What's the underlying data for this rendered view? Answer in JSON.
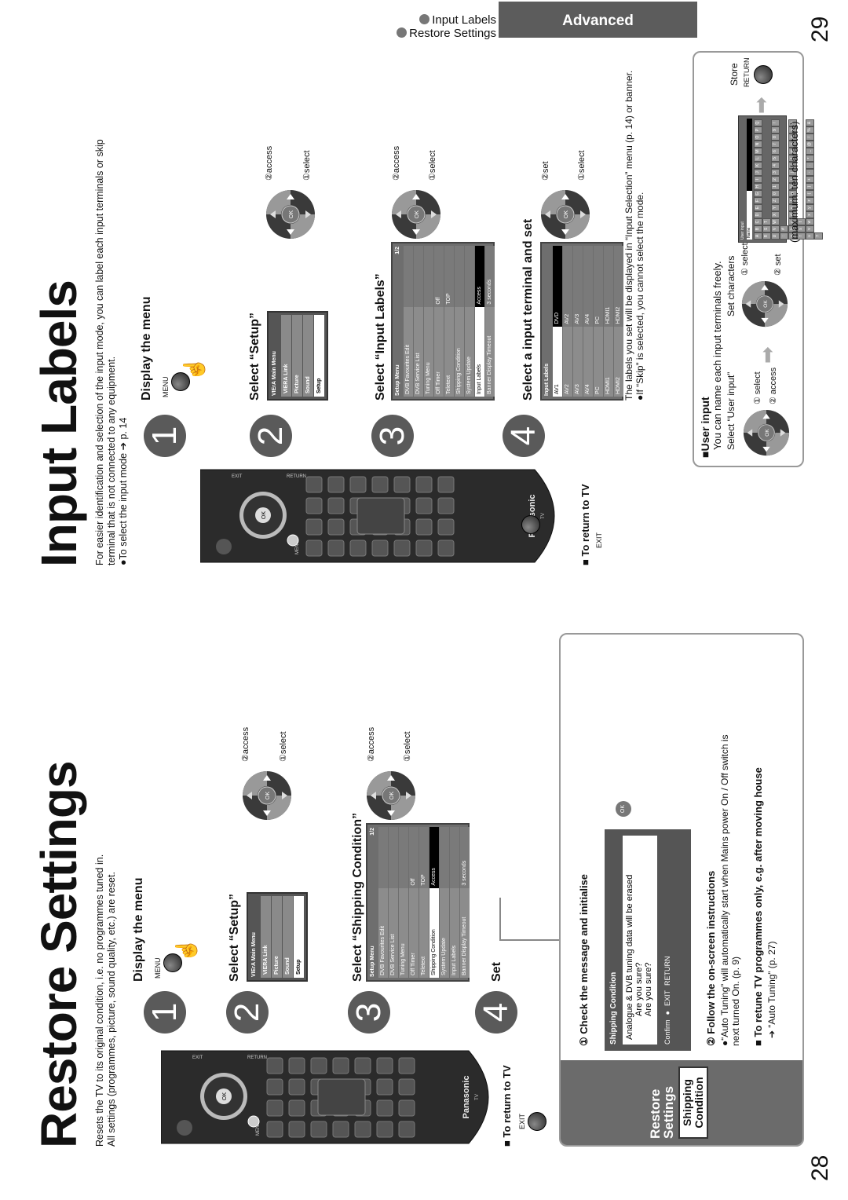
{
  "header": {
    "tab": "Advanced",
    "links": [
      "Input Labels",
      "Restore Settings"
    ]
  },
  "colors": {
    "tab_bg": "#5c5c5c",
    "step_circle": "#5a5a5a",
    "sidebar_bg": "#6b6b6b"
  },
  "left": {
    "page_number": "28",
    "title": "Restore Settings",
    "intro": [
      "Resets the TV to its original condition, i.e. no programmes tuned in.",
      "All settings (programmes, picture, sound quality, etc.) are reset."
    ],
    "remote": {
      "brand": "Panasonic",
      "sub": "TV",
      "menu": "MENU",
      "exit": "EXIT",
      "return": "RETURN",
      "ok": "OK"
    },
    "steps": [
      {
        "num": "1",
        "heading": "Display the menu",
        "button": "MENU"
      },
      {
        "num": "2",
        "heading": "Select “Setup”",
        "access": "②access",
        "select": "①select"
      },
      {
        "num": "3",
        "heading": "Select “Shipping Condition”",
        "access": "②access",
        "select": "①select"
      },
      {
        "num": "4",
        "heading": "Set"
      }
    ],
    "return_tv": {
      "label": "■ To return to TV",
      "button": "EXIT"
    },
    "main_menu": {
      "title": "VIErA Main Menu",
      "items": [
        "VIERA Link",
        "Picture",
        "Sound",
        "Setup"
      ],
      "selected": 3
    },
    "setup_menu": {
      "title": "Setup Menu",
      "page": "1/2",
      "rows": [
        [
          "DVB Favourites Edit",
          ""
        ],
        [
          "DVB Service List",
          ""
        ],
        [
          "Tuning Menu",
          ""
        ],
        [
          "Off Timer",
          "Off"
        ],
        [
          "Teletext",
          "TOP"
        ],
        [
          "Shipping Condition",
          "Access"
        ],
        [
          "System Update",
          ""
        ],
        [
          "Input Labels",
          ""
        ],
        [
          "Banner Display Timeout",
          "3 seconds"
        ]
      ],
      "selected": 5
    },
    "box": {
      "sidebar_title": "Restore Settings",
      "sidebar_badge": "Shipping Condition",
      "check": "① Check the message and initialise",
      "dialog": {
        "title": "Shipping Condition",
        "message": "Analogue & DVB tuning data will be erased",
        "q1": "Are you sure?",
        "q2": "Are you sure?",
        "confirm": "Confirm",
        "exit": "EXIT",
        "return": "RETURN"
      },
      "ok": "OK",
      "follow": "② Follow the on-screen instructions",
      "bullet": "●“Auto Tuning” will automatically start when Mains power On / Off switch is next turned On. (p. 9)",
      "retune": "■ To retune TV programmes only, e.g. after moving house",
      "retune_ref": "➔ “Auto Tuning” (p. 27)"
    }
  },
  "right": {
    "page_number": "29",
    "title": "Input Labels",
    "intro": [
      "For easier identification and selection of the input mode, you can label each input terminals or skip",
      "terminal that is not connected to any equipment.",
      "●To select the input mode ➔ p. 14"
    ],
    "remote": {
      "brand": "Panasonic",
      "sub": "TV",
      "menu": "MENU",
      "exit": "EXIT",
      "return": "RETURN",
      "ok": "OK"
    },
    "steps": [
      {
        "num": "1",
        "heading": "Display the menu",
        "button": "MENU"
      },
      {
        "num": "2",
        "heading": "Select “Setup”",
        "access": "②access",
        "select": "①select"
      },
      {
        "num": "3",
        "heading": "Select “Input Labels”",
        "access": "②access",
        "select": "①select"
      },
      {
        "num": "4",
        "heading": "Select a input terminal and set",
        "access": "②set",
        "select": "①select"
      }
    ],
    "return_tv": {
      "label": "■ To return to TV",
      "button": "EXIT"
    },
    "main_menu": {
      "title": "VIErA Main Menu",
      "items": [
        "VIERA Link",
        "Picture",
        "Sound",
        "Setup"
      ],
      "selected": 3
    },
    "setup_menu": {
      "title": "Setup Menu",
      "page": "1/2",
      "rows": [
        [
          "DVB Favourites Edit",
          ""
        ],
        [
          "DVB Service List",
          ""
        ],
        [
          "Tuning Menu",
          ""
        ],
        [
          "Off Timer",
          "Off"
        ],
        [
          "Teletext",
          "TOP"
        ],
        [
          "Shipping Condition",
          ""
        ],
        [
          "System Update",
          ""
        ],
        [
          "Input Labels",
          "Access"
        ],
        [
          "Banner Display Timeout",
          "3 seconds"
        ]
      ],
      "selected": 7
    },
    "input_menu": {
      "title": "Input Labels",
      "rows": [
        [
          "AV1",
          "DVD"
        ],
        [
          "AV2",
          "AV2"
        ],
        [
          "AV3",
          "AV3"
        ],
        [
          "AV4",
          "AV4"
        ],
        [
          "PC",
          "PC"
        ],
        [
          "HDMI1",
          "HDMI1"
        ],
        [
          "HDMI2",
          "HDMI2"
        ]
      ],
      "selected": 0
    },
    "note1": "The labels you set will be displayed in “Input Selection” menu (p. 14) or banner.",
    "note2": "●If “Skip” is selected, you cannot select the mode.",
    "user_input": {
      "heading": "■User input",
      "desc": "You can name each input terminals freely.",
      "select_label": "Select “User input”",
      "set_label": "Set characters",
      "d1_select": "① select",
      "d1_access": "② access",
      "d2_select": "① select",
      "d2_set": "② set",
      "panel_title": "User input",
      "panel_name": "Name",
      "keys": [
        "ABCDEFGHIJKLMNOPQRST",
        "UVWXYZ0123456789!:#",
        "abcdefghijklmnopqrst",
        "uvwxyz()+-.*_@/%&?"
      ],
      "max": "(maximum: ten characters)",
      "store": "Store",
      "return": "RETURN"
    }
  }
}
